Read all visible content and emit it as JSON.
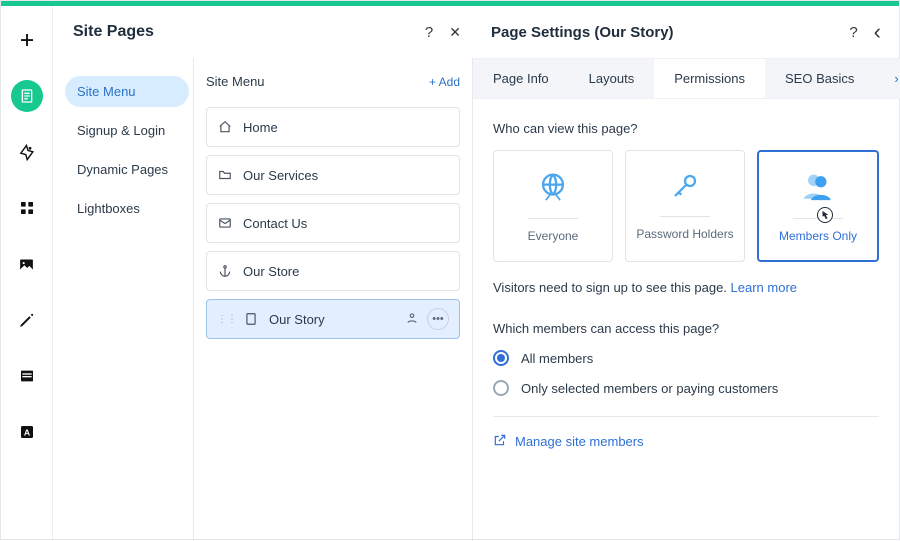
{
  "colors": {
    "accent": "#17c88f",
    "link": "#2f6fd6",
    "selection": "#d7ecff"
  },
  "rail_icons": [
    "plus-icon",
    "page-icon",
    "design-icon",
    "apps-icon",
    "media-icon",
    "blog-icon",
    "cms-icon",
    "font-icon"
  ],
  "rail_active_index": 1,
  "left": {
    "title": "Site Pages",
    "help_glyph": "?",
    "close_glyph": "✕",
    "nav": [
      {
        "label": "Site Menu",
        "selected": true
      },
      {
        "label": "Signup & Login",
        "selected": false
      },
      {
        "label": "Dynamic Pages",
        "selected": false
      },
      {
        "label": "Lightboxes",
        "selected": false
      }
    ],
    "list": {
      "heading": "Site Menu",
      "add_label": "+ Add",
      "items": [
        {
          "icon": "home-icon",
          "label": "Home",
          "selected": false
        },
        {
          "icon": "folder-icon",
          "label": "Our Services",
          "selected": false
        },
        {
          "icon": "mail-icon",
          "label": "Contact Us",
          "selected": false
        },
        {
          "icon": "anchor-icon",
          "label": "Our Store",
          "selected": false
        },
        {
          "icon": "page-icon",
          "label": "Our Story",
          "selected": true
        }
      ]
    }
  },
  "settings": {
    "title": "Page Settings (Our Story)",
    "help_glyph": "?",
    "back_glyph": "‹",
    "tabs": [
      {
        "label": "Page Info",
        "active": false
      },
      {
        "label": "Layouts",
        "active": false
      },
      {
        "label": "Permissions",
        "active": true
      },
      {
        "label": "SEO Basics",
        "active": false
      }
    ],
    "more_glyph": "›",
    "q_view": "Who can view this page?",
    "cards": [
      {
        "key": "everyone",
        "label": "Everyone",
        "icon": "globe-icon",
        "selected": false
      },
      {
        "key": "password",
        "label": "Password Holders",
        "icon": "key-icon",
        "selected": false
      },
      {
        "key": "members",
        "label": "Members Only",
        "icon": "members-icon",
        "selected": true
      }
    ],
    "hint_text": "Visitors need to sign up to see this page. ",
    "hint_link": "Learn more",
    "q_members": "Which members can access this page?",
    "radios": [
      {
        "label": "All members",
        "on": true
      },
      {
        "label": "Only selected members or paying customers",
        "on": false
      }
    ],
    "manage_link": "Manage site members"
  }
}
